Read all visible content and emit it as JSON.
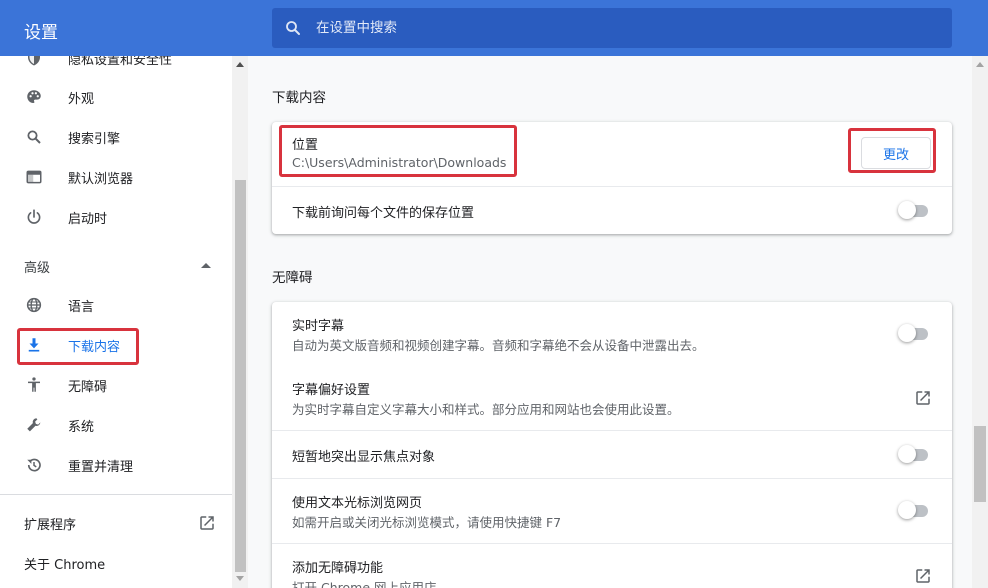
{
  "header": {
    "title": "设置",
    "search_placeholder": "在设置中搜索"
  },
  "sidebar": {
    "items_top": [
      {
        "label": "隐私设置和安全性",
        "icon": "shield-icon"
      },
      {
        "label": "外观",
        "icon": "palette-icon"
      },
      {
        "label": "搜索引擎",
        "icon": "search-icon"
      },
      {
        "label": "默认浏览器",
        "icon": "browser-icon"
      },
      {
        "label": "启动时",
        "icon": "power-icon"
      }
    ],
    "advanced_label": "高级",
    "items_advanced": [
      {
        "label": "语言",
        "icon": "globe-icon"
      },
      {
        "label": "下载内容",
        "icon": "download-icon"
      },
      {
        "label": "无障碍",
        "icon": "accessibility-icon"
      },
      {
        "label": "系统",
        "icon": "wrench-icon"
      },
      {
        "label": "重置并清理",
        "icon": "restore-icon"
      }
    ],
    "extensions_label": "扩展程序",
    "about_label": "关于 Chrome"
  },
  "downloads": {
    "section_title": "下载内容",
    "location_title": "位置",
    "location_path": "C:\\Users\\Administrator\\Downloads",
    "change_button": "更改",
    "ask_location_label": "下载前询问每个文件的保存位置",
    "ask_location_on": false
  },
  "accessibility": {
    "section_title": "无障碍",
    "rows": [
      {
        "title": "实时字幕",
        "subtitle": "自动为英文版音频和视频创建字幕。音频和字幕绝不会从设备中泄露出去。",
        "control": "toggle",
        "on": false
      },
      {
        "title": "字幕偏好设置",
        "subtitle": "为实时字幕自定义字幕大小和样式。部分应用和网站也会使用此设置。",
        "control": "external-link-icon"
      },
      {
        "title": "短暂地突出显示焦点对象",
        "subtitle": "",
        "control": "toggle",
        "on": false
      },
      {
        "title": "使用文本光标浏览网页",
        "subtitle": "如需开启或关闭光标浏览模式，请使用快捷键 F7",
        "control": "toggle",
        "on": false
      },
      {
        "title": "添加无障碍功能",
        "subtitle": "打开 Chrome 网上应用店",
        "control": "external-link-icon"
      }
    ]
  },
  "colors": {
    "header_bg": "#3b74d8",
    "accent": "#1a73e8",
    "highlight": "#d8333d"
  }
}
